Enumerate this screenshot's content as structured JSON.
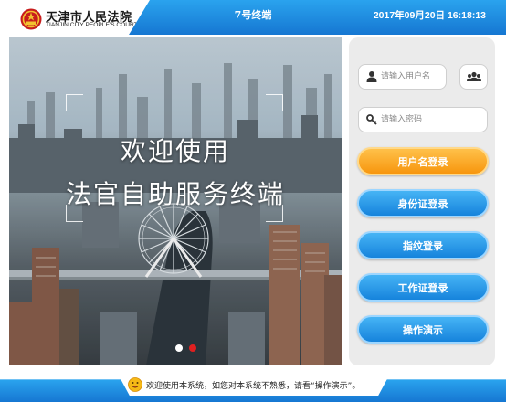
{
  "header": {
    "court_name_cn": "天津市人民法院",
    "court_name_en": "TIANJIN CITY PEOPLE'S COURT",
    "terminal_name": "7号终端",
    "datetime": "2017年09月20日 16:18:13",
    "emblem_icon": "national-emblem-icon"
  },
  "banner": {
    "welcome_line1": "欢迎使用",
    "welcome_line2": "法官自助服务终端",
    "carousel_dots": 2,
    "active_dot": 2
  },
  "login": {
    "username_placeholder": "请输入用户名",
    "username_value": "",
    "password_placeholder": "请输入密码",
    "password_value": "",
    "buttons": {
      "username_login": "用户名登录",
      "id_card_login": "身份证登录",
      "fingerprint_login": "指纹登录",
      "work_card_login": "工作证登录",
      "demo": "操作演示"
    },
    "icons": [
      "user-icon",
      "key-icon",
      "user-group-icon"
    ]
  },
  "footer": {
    "tip": "欢迎使用本系统，如您对本系统不熟悉，请看“操作演示”。",
    "tip_icon": "smiley-icon"
  },
  "colors": {
    "header_blue": "#1677d2",
    "primary_button": "#f7960e",
    "secondary_button": "#1683dc",
    "active_dot": "#e02020"
  }
}
